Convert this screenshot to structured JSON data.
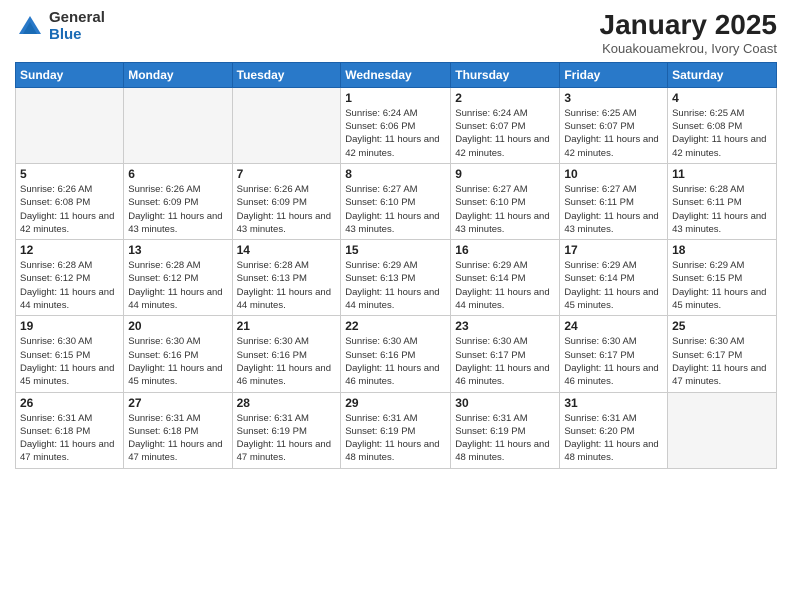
{
  "logo": {
    "general": "General",
    "blue": "Blue"
  },
  "header": {
    "title": "January 2025",
    "subtitle": "Kouakouamekrou, Ivory Coast"
  },
  "weekdays": [
    "Sunday",
    "Monday",
    "Tuesday",
    "Wednesday",
    "Thursday",
    "Friday",
    "Saturday"
  ],
  "weeks": [
    [
      {
        "day": "",
        "info": ""
      },
      {
        "day": "",
        "info": ""
      },
      {
        "day": "",
        "info": ""
      },
      {
        "day": "1",
        "info": "Sunrise: 6:24 AM\nSunset: 6:06 PM\nDaylight: 11 hours and 42 minutes."
      },
      {
        "day": "2",
        "info": "Sunrise: 6:24 AM\nSunset: 6:07 PM\nDaylight: 11 hours and 42 minutes."
      },
      {
        "day": "3",
        "info": "Sunrise: 6:25 AM\nSunset: 6:07 PM\nDaylight: 11 hours and 42 minutes."
      },
      {
        "day": "4",
        "info": "Sunrise: 6:25 AM\nSunset: 6:08 PM\nDaylight: 11 hours and 42 minutes."
      }
    ],
    [
      {
        "day": "5",
        "info": "Sunrise: 6:26 AM\nSunset: 6:08 PM\nDaylight: 11 hours and 42 minutes."
      },
      {
        "day": "6",
        "info": "Sunrise: 6:26 AM\nSunset: 6:09 PM\nDaylight: 11 hours and 43 minutes."
      },
      {
        "day": "7",
        "info": "Sunrise: 6:26 AM\nSunset: 6:09 PM\nDaylight: 11 hours and 43 minutes."
      },
      {
        "day": "8",
        "info": "Sunrise: 6:27 AM\nSunset: 6:10 PM\nDaylight: 11 hours and 43 minutes."
      },
      {
        "day": "9",
        "info": "Sunrise: 6:27 AM\nSunset: 6:10 PM\nDaylight: 11 hours and 43 minutes."
      },
      {
        "day": "10",
        "info": "Sunrise: 6:27 AM\nSunset: 6:11 PM\nDaylight: 11 hours and 43 minutes."
      },
      {
        "day": "11",
        "info": "Sunrise: 6:28 AM\nSunset: 6:11 PM\nDaylight: 11 hours and 43 minutes."
      }
    ],
    [
      {
        "day": "12",
        "info": "Sunrise: 6:28 AM\nSunset: 6:12 PM\nDaylight: 11 hours and 44 minutes."
      },
      {
        "day": "13",
        "info": "Sunrise: 6:28 AM\nSunset: 6:12 PM\nDaylight: 11 hours and 44 minutes."
      },
      {
        "day": "14",
        "info": "Sunrise: 6:28 AM\nSunset: 6:13 PM\nDaylight: 11 hours and 44 minutes."
      },
      {
        "day": "15",
        "info": "Sunrise: 6:29 AM\nSunset: 6:13 PM\nDaylight: 11 hours and 44 minutes."
      },
      {
        "day": "16",
        "info": "Sunrise: 6:29 AM\nSunset: 6:14 PM\nDaylight: 11 hours and 44 minutes."
      },
      {
        "day": "17",
        "info": "Sunrise: 6:29 AM\nSunset: 6:14 PM\nDaylight: 11 hours and 45 minutes."
      },
      {
        "day": "18",
        "info": "Sunrise: 6:29 AM\nSunset: 6:15 PM\nDaylight: 11 hours and 45 minutes."
      }
    ],
    [
      {
        "day": "19",
        "info": "Sunrise: 6:30 AM\nSunset: 6:15 PM\nDaylight: 11 hours and 45 minutes."
      },
      {
        "day": "20",
        "info": "Sunrise: 6:30 AM\nSunset: 6:16 PM\nDaylight: 11 hours and 45 minutes."
      },
      {
        "day": "21",
        "info": "Sunrise: 6:30 AM\nSunset: 6:16 PM\nDaylight: 11 hours and 46 minutes."
      },
      {
        "day": "22",
        "info": "Sunrise: 6:30 AM\nSunset: 6:16 PM\nDaylight: 11 hours and 46 minutes."
      },
      {
        "day": "23",
        "info": "Sunrise: 6:30 AM\nSunset: 6:17 PM\nDaylight: 11 hours and 46 minutes."
      },
      {
        "day": "24",
        "info": "Sunrise: 6:30 AM\nSunset: 6:17 PM\nDaylight: 11 hours and 46 minutes."
      },
      {
        "day": "25",
        "info": "Sunrise: 6:30 AM\nSunset: 6:17 PM\nDaylight: 11 hours and 47 minutes."
      }
    ],
    [
      {
        "day": "26",
        "info": "Sunrise: 6:31 AM\nSunset: 6:18 PM\nDaylight: 11 hours and 47 minutes."
      },
      {
        "day": "27",
        "info": "Sunrise: 6:31 AM\nSunset: 6:18 PM\nDaylight: 11 hours and 47 minutes."
      },
      {
        "day": "28",
        "info": "Sunrise: 6:31 AM\nSunset: 6:19 PM\nDaylight: 11 hours and 47 minutes."
      },
      {
        "day": "29",
        "info": "Sunrise: 6:31 AM\nSunset: 6:19 PM\nDaylight: 11 hours and 48 minutes."
      },
      {
        "day": "30",
        "info": "Sunrise: 6:31 AM\nSunset: 6:19 PM\nDaylight: 11 hours and 48 minutes."
      },
      {
        "day": "31",
        "info": "Sunrise: 6:31 AM\nSunset: 6:20 PM\nDaylight: 11 hours and 48 minutes."
      },
      {
        "day": "",
        "info": ""
      }
    ]
  ]
}
